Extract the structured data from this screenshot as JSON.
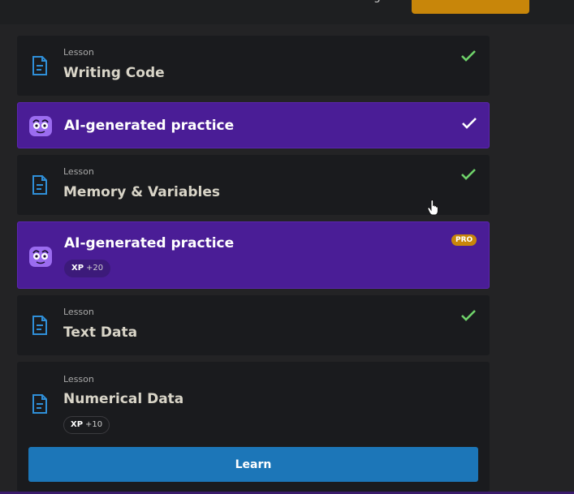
{
  "header": {
    "partial_text": "g",
    "primary_button_label": ""
  },
  "items": [
    {
      "eyebrow": "Lesson",
      "title": "Writing Code",
      "completed": true
    },
    {
      "title": "AI-generated practice",
      "completed": true
    },
    {
      "eyebrow": "Lesson",
      "title": "Memory & Variables",
      "completed": true
    },
    {
      "title": "AI-generated practice",
      "badge": "PRO",
      "xp_label": "XP",
      "xp_value": "+20"
    },
    {
      "eyebrow": "Lesson",
      "title": "Text Data",
      "completed": true
    },
    {
      "eyebrow": "Lesson",
      "title": "Numerical Data",
      "xp_label": "XP",
      "xp_value": "+10",
      "button_label": "Learn"
    }
  ],
  "colors": {
    "background": "#232325",
    "card": "#1a1b1e",
    "ai_card": "#4a1d96",
    "check": "#6fd36a",
    "doc_icon": "#2f8fd8",
    "accent_orange": "#c8860a",
    "learn_button": "#1c76b8"
  },
  "icons": {
    "lesson": "document-icon",
    "ai": "robot-face-icon",
    "done": "checkmark-icon"
  }
}
